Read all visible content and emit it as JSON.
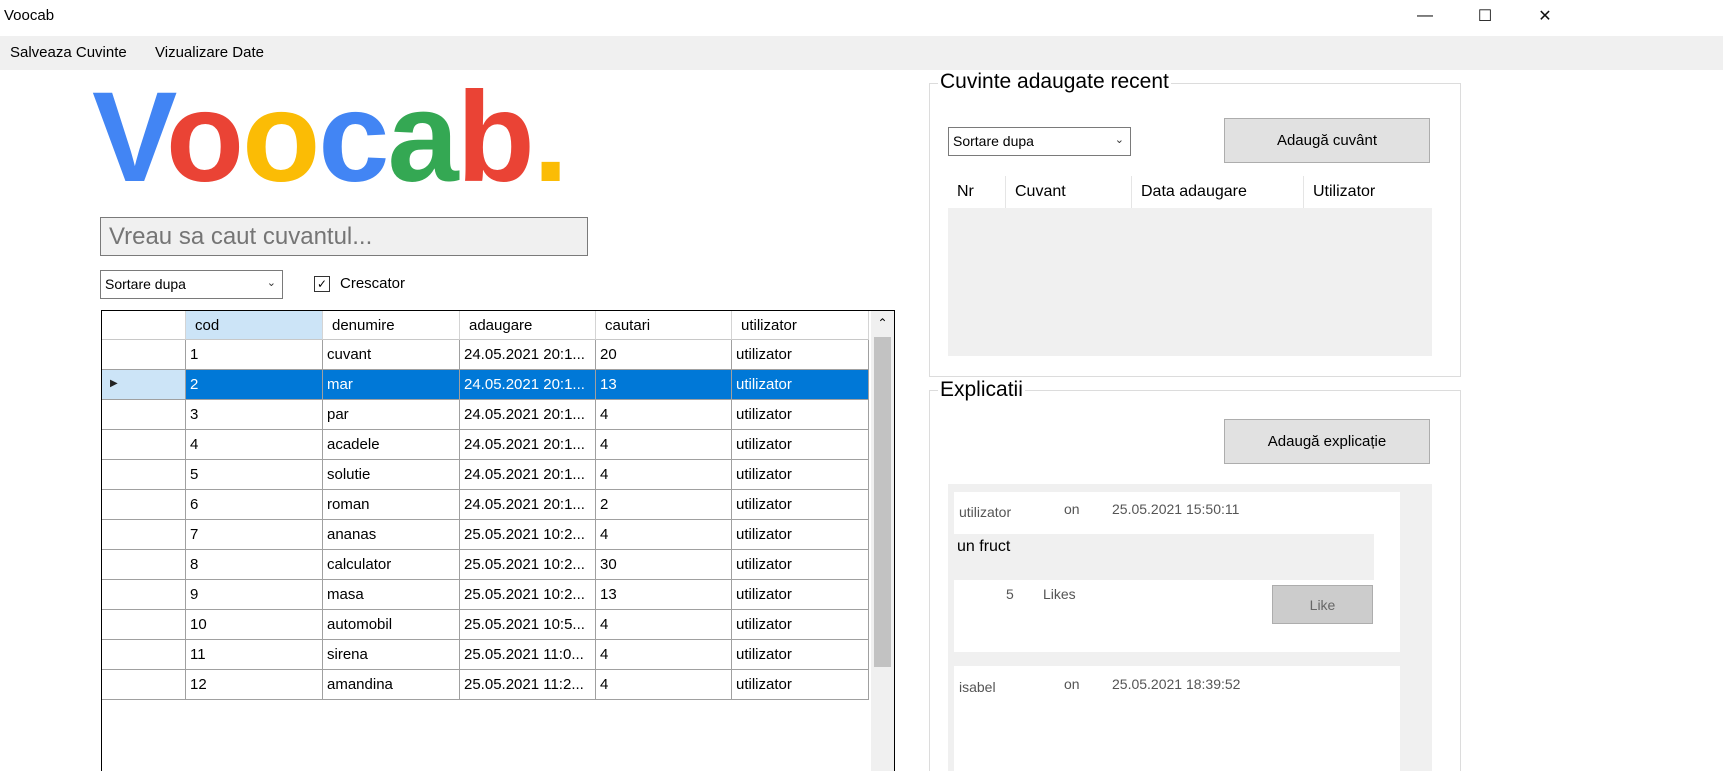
{
  "window": {
    "title": "Voocab",
    "minimize": "—",
    "maximize": "☐",
    "close": "✕"
  },
  "menu": {
    "items": [
      "Salveaza Cuvinte",
      "Vizualizare Date"
    ]
  },
  "logo": {
    "letters": [
      "V",
      "o",
      "o",
      "c",
      "a",
      "b",
      "."
    ],
    "colors": [
      "#4285F4",
      "#EA4335",
      "#FBBC05",
      "#4285F4",
      "#34A853",
      "#EA4335",
      "#FBBC05"
    ]
  },
  "search": {
    "placeholder": "Vreau sa caut cuvantul..."
  },
  "sort": {
    "label": "Sortare dupa",
    "checkbox_label": "Crescator",
    "checked": true
  },
  "grid": {
    "columns": [
      "cod",
      "denumire",
      "adaugare",
      "cautari",
      "utilizator"
    ],
    "selected_row": 1,
    "rows": [
      [
        "1",
        "cuvant",
        "24.05.2021 20:1...",
        "20",
        "utilizator"
      ],
      [
        "2",
        "mar",
        "24.05.2021 20:1...",
        "13",
        "utilizator"
      ],
      [
        "3",
        "par",
        "24.05.2021 20:1...",
        "4",
        "utilizator"
      ],
      [
        "4",
        "acadele",
        "24.05.2021 20:1...",
        "4",
        "utilizator"
      ],
      [
        "5",
        "solutie",
        "24.05.2021 20:1...",
        "4",
        "utilizator"
      ],
      [
        "6",
        "roman",
        "24.05.2021 20:1...",
        "2",
        "utilizator"
      ],
      [
        "7",
        "ananas",
        "25.05.2021 10:2...",
        "4",
        "utilizator"
      ],
      [
        "8",
        "calculator",
        "25.05.2021 10:2...",
        "30",
        "utilizator"
      ],
      [
        "9",
        "masa",
        "25.05.2021 10:2...",
        "13",
        "utilizator"
      ],
      [
        "10",
        "automobil",
        "25.05.2021 10:5...",
        "4",
        "utilizator"
      ],
      [
        "11",
        "sirena",
        "25.05.2021 11:0...",
        "4",
        "utilizator"
      ],
      [
        "12",
        "amandina",
        "25.05.2021 11:2...",
        "4",
        "utilizator"
      ]
    ]
  },
  "recent": {
    "title": "Cuvinte adaugate recent",
    "sort_label": "Sortare dupa",
    "add_button": "Adaugă cuvânt",
    "columns": [
      "Nr",
      "Cuvant",
      "Data adaugare",
      "Utilizator"
    ]
  },
  "explanations": {
    "title": "Explicatii",
    "add_button": "Adaugă explicație",
    "cards": [
      {
        "user": "utilizator",
        "on": "on",
        "date": "25.05.2021 15:50:11",
        "text": "un fruct",
        "likes": "5",
        "likes_label": "Likes",
        "like_button": "Like"
      },
      {
        "user": "isabel",
        "on": "on",
        "date": "25.05.2021 18:39:52"
      }
    ]
  }
}
